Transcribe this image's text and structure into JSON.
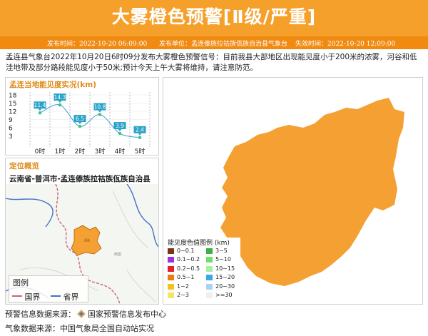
{
  "header": {
    "title": "大雾橙色预警[Ⅱ级/严重]"
  },
  "infobar": {
    "publish_time": "发布时间：2022-10-20 06:09:00",
    "publisher": "发布单位：孟连傣族拉祜族佤族自治县气象台",
    "expire_time": "失效时间：2022-10-20 12:09:00"
  },
  "description": "孟连县气象台2022年10月20日6时09分发布大雾橙色预警信号：目前我县大部地区出现能见度小于200米的浓雾，河谷和低洼地带及部分路段能见度小于50米;预计今天上午大雾将维持，请注意防范。",
  "visibility_panel": {
    "title": "孟连当地能见度实况(km)"
  },
  "chart_data": {
    "type": "line",
    "title": "孟连当地能见度实况(km)",
    "categories": [
      "0时",
      "1时",
      "2时",
      "3时",
      "4时",
      "5时"
    ],
    "values": [
      11.4,
      14.3,
      6.5,
      10.8,
      3.9,
      2.4
    ],
    "ylim": [
      0,
      18
    ],
    "yticks": [
      "3",
      "6",
      "9",
      "12",
      "15",
      "18"
    ],
    "grid": true,
    "line_color": "#3b9ad9",
    "label_color": "#2aa3c8",
    "point_color": "#3cc47a"
  },
  "location_panel": {
    "title": "定位概览",
    "location": "云南省-普洱市-孟连傣族拉祜族佤族自治县",
    "region_color": "#f5a033",
    "map_legend": {
      "title": "图例",
      "items": [
        {
          "label": "国界",
          "color": "#c8667a"
        },
        {
          "label": "省界",
          "color": "#4470c4"
        }
      ]
    }
  },
  "visibility_legend": {
    "title": "能见度色值图例 (km)",
    "items": [
      {
        "label": "0~0.1",
        "color": "#7a3414"
      },
      {
        "label": "3~5",
        "color": "#3cb043"
      },
      {
        "label": "0.1~0.2",
        "color": "#9b30e0"
      },
      {
        "label": "5~10",
        "color": "#6fe06b"
      },
      {
        "label": "0.2~0.5",
        "color": "#e0202a"
      },
      {
        "label": "10~15",
        "color": "#a8f0a0"
      },
      {
        "label": "0.5~1",
        "color": "#f07a10"
      },
      {
        "label": "15~20",
        "color": "#3aa8e8"
      },
      {
        "label": "1~2",
        "color": "#f5c21a"
      },
      {
        "label": "20~30",
        "color": "#a8d4f2"
      },
      {
        "label": "2~3",
        "color": "#f5e26b"
      },
      {
        "label": ">=30",
        "color": "#efefef"
      }
    ]
  },
  "map_region_color": "#f5a033",
  "footer": {
    "source1_label": "预警信息数据来源：",
    "source1_value": "国家预警信息发布中心",
    "source2": "气象数据来源：中国气象局全国自动站实况"
  }
}
